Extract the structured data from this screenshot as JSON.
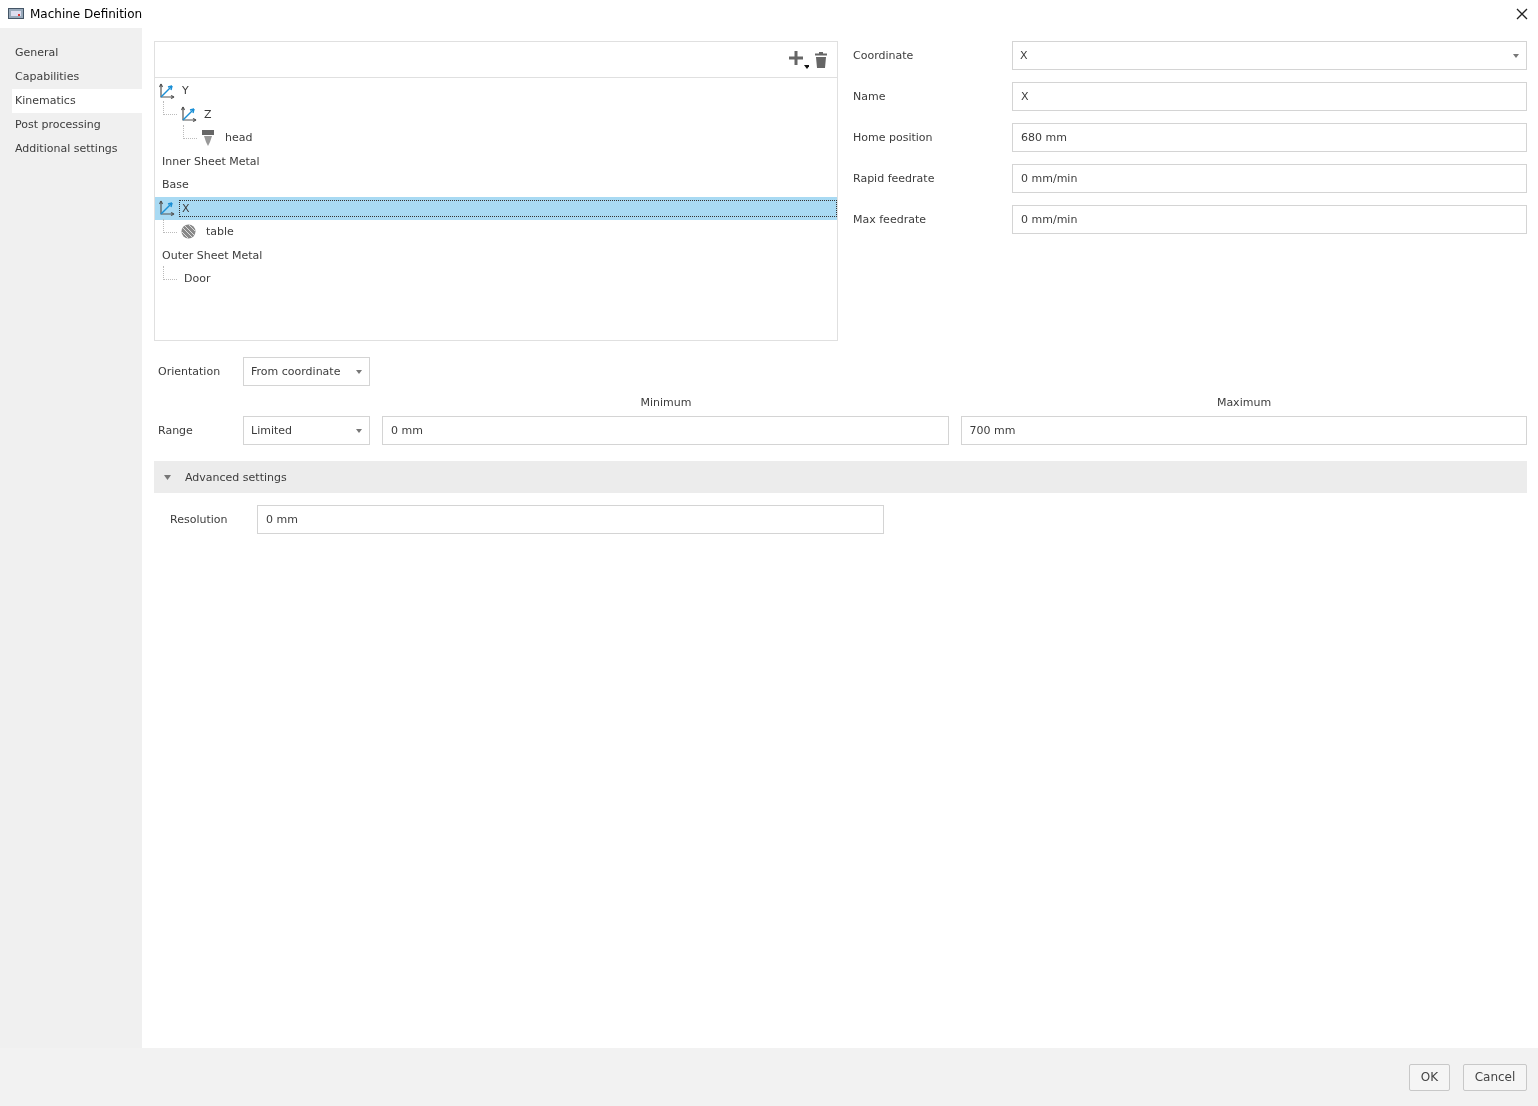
{
  "window": {
    "title": "Machine Definition"
  },
  "sidebar": {
    "items": [
      {
        "label": "General",
        "selected": false
      },
      {
        "label": "Capabilities",
        "selected": false
      },
      {
        "label": "Kinematics",
        "selected": true
      },
      {
        "label": "Post processing",
        "selected": false
      },
      {
        "label": "Additional settings",
        "selected": false
      }
    ]
  },
  "tree": {
    "items": [
      {
        "label": "Y",
        "kind": "axis",
        "selected": false,
        "children": [
          {
            "label": "Z",
            "kind": "axis",
            "selected": false,
            "children": [
              {
                "label": "head",
                "kind": "tool",
                "selected": false
              }
            ]
          }
        ]
      },
      {
        "label": "Inner Sheet Metal",
        "kind": "part",
        "selected": false
      },
      {
        "label": "Base",
        "kind": "part",
        "selected": false
      },
      {
        "label": "X",
        "kind": "axis",
        "selected": true,
        "children": [
          {
            "label": "table",
            "kind": "table",
            "selected": false
          }
        ]
      },
      {
        "label": "Outer Sheet Metal",
        "kind": "part",
        "selected": false,
        "children": [
          {
            "label": "Door",
            "kind": "part",
            "selected": false
          }
        ]
      }
    ]
  },
  "properties": [
    {
      "label": "Coordinate",
      "value": "X",
      "kind": "select"
    },
    {
      "label": "Name",
      "value": "X",
      "kind": "text"
    },
    {
      "label": "Home position",
      "value": "680 mm",
      "kind": "text"
    },
    {
      "label": "Rapid feedrate",
      "value": "0 mm/min",
      "kind": "text"
    },
    {
      "label": "Max feedrate",
      "value": "0 mm/min",
      "kind": "text"
    }
  ],
  "orientation": {
    "label": "Orientation",
    "value": "From coordinate"
  },
  "range": {
    "label": "Range",
    "value": "Limited",
    "minimum_header": "Minimum",
    "minimum": "0 mm",
    "maximum_header": "Maximum",
    "maximum": "700 mm"
  },
  "advanced": {
    "label": "Advanced settings",
    "expanded": true,
    "resolution_label": "Resolution",
    "resolution": "0 mm"
  },
  "buttons": [
    "OK",
    "Cancel"
  ]
}
